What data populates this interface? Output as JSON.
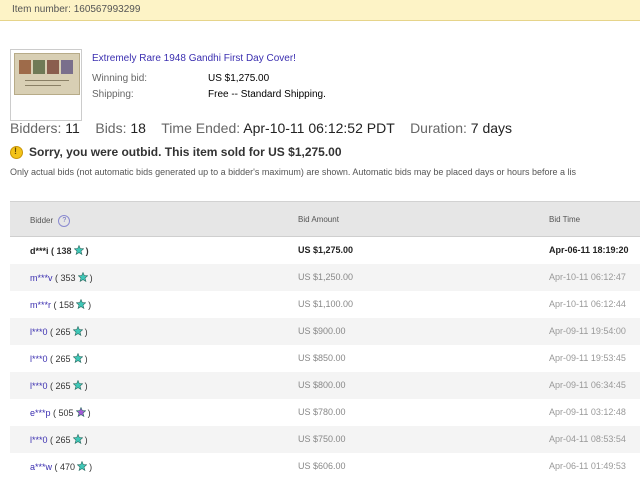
{
  "item_bar": {
    "text": "Item number: 160567993299"
  },
  "item": {
    "title": "Extremely Rare 1948 Gandhi First Day Cover!",
    "winning_bid_label": "Winning bid:",
    "winning_bid_value": "US $1,275.00",
    "shipping_label": "Shipping:",
    "shipping_value": "Free -- Standard Shipping."
  },
  "stats": {
    "bidders_label": "Bidders:",
    "bidders_value": "11",
    "bids_label": "Bids:",
    "bids_value": "18",
    "time_ended_label": "Time Ended:",
    "time_ended_value": "Apr-10-11 06:12:52 PDT",
    "duration_label": "Duration:",
    "duration_value": "7 days"
  },
  "outbid_message": "Sorry, you were outbid. This item sold for US $1,275.00",
  "note": "Only actual bids (not automatic bids generated up to a bidder's maximum) are shown. Automatic bids may be placed days or hours before a lis",
  "table": {
    "headers": {
      "bidder": "Bidder",
      "help": "?",
      "amount": "Bid Amount",
      "time": "Bid Time"
    },
    "rows": [
      {
        "bidder": "d***i",
        "feedback": "138",
        "star": "turquoise",
        "amount": "US $1,275.00",
        "time": "Apr-06-11 18:19:20"
      },
      {
        "bidder": "m***v",
        "feedback": "353",
        "star": "turquoise",
        "amount": "US $1,250.00",
        "time": "Apr-10-11 06:12:47"
      },
      {
        "bidder": "m***r",
        "feedback": "158",
        "star": "turquoise",
        "amount": "US $1,100.00",
        "time": "Apr-10-11 06:12:44"
      },
      {
        "bidder": "l***0",
        "feedback": "265",
        "star": "turquoise",
        "amount": "US $900.00",
        "time": "Apr-09-11 19:54:00"
      },
      {
        "bidder": "l***0",
        "feedback": "265",
        "star": "turquoise",
        "amount": "US $850.00",
        "time": "Apr-09-11 19:53:45"
      },
      {
        "bidder": "l***0",
        "feedback": "265",
        "star": "turquoise",
        "amount": "US $800.00",
        "time": "Apr-09-11 06:34:45"
      },
      {
        "bidder": "e***p",
        "feedback": "505",
        "star": "purple",
        "amount": "US $780.00",
        "time": "Apr-09-11 03:12:48"
      },
      {
        "bidder": "l***0",
        "feedback": "265",
        "star": "turquoise",
        "amount": "US $750.00",
        "time": "Apr-04-11 08:53:54"
      },
      {
        "bidder": "a***w",
        "feedback": "470",
        "star": "turquoise",
        "amount": "US $606.00",
        "time": "Apr-06-11 01:49:53"
      }
    ]
  },
  "colors": {
    "turquoise_star": "#3fc8b8",
    "purple_star": "#a35bd6",
    "link": "#3b2fb0",
    "banner": "#fdf3c6"
  }
}
